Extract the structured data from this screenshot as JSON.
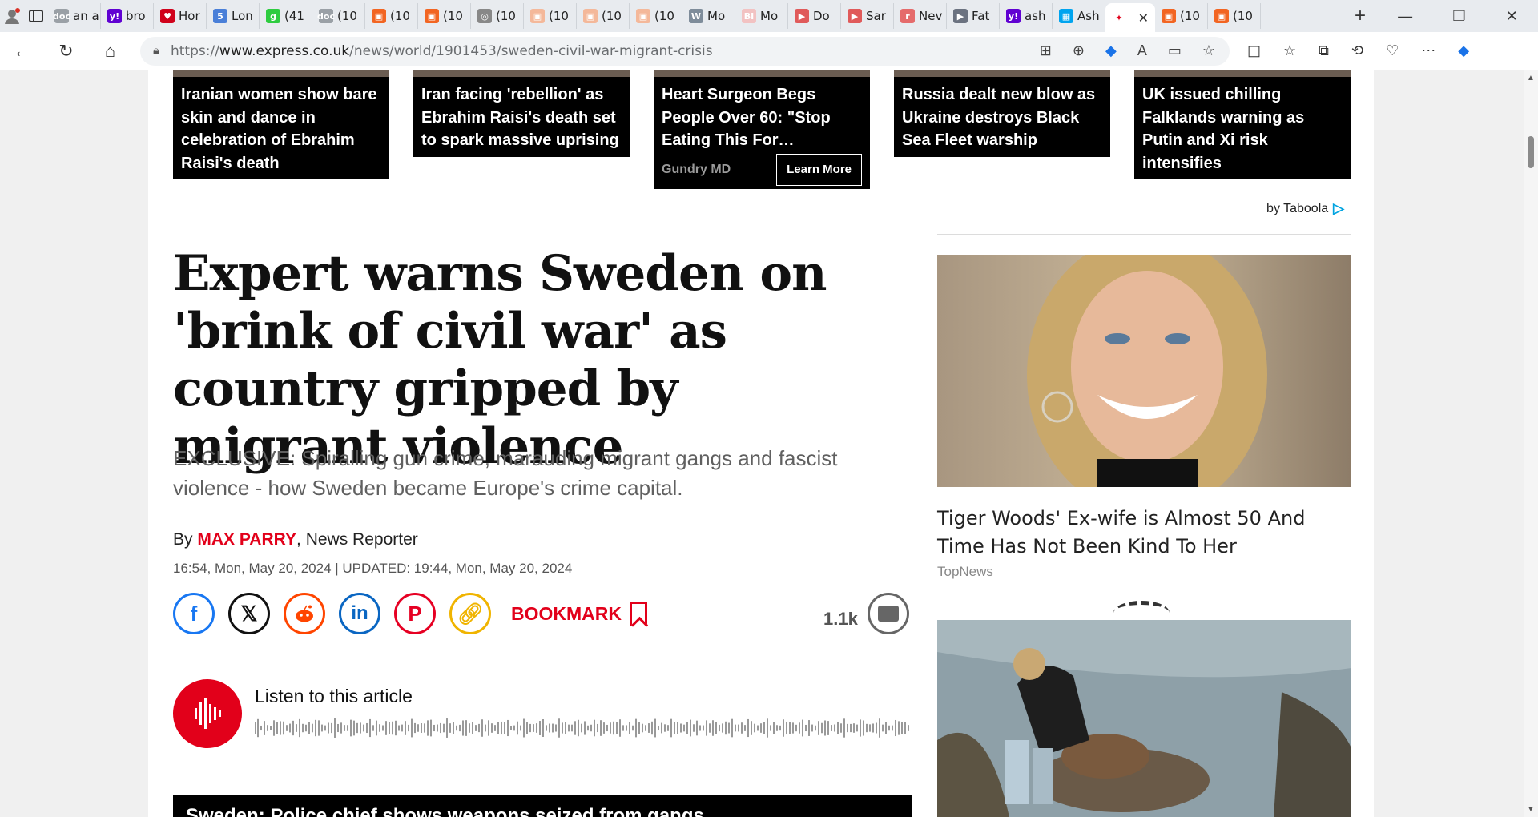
{
  "browser": {
    "tabs": [
      {
        "label": "an a",
        "fav_color": "#9aa0a6",
        "fav": "doc"
      },
      {
        "label": "bro",
        "fav_color": "#6001d2",
        "fav": "y!"
      },
      {
        "label": "Hor",
        "fav_color": "#d0021b",
        "fav": "♥"
      },
      {
        "label": "Lon",
        "fav_color": "#4a7fd8",
        "fav": "5"
      },
      {
        "label": "(41",
        "fav_color": "#2ecc40",
        "fav": "g"
      },
      {
        "label": "(10",
        "fav_color": "#9aa0a6",
        "fav": "doc"
      },
      {
        "label": "(10",
        "fav_color": "#f26522",
        "fav": "▣"
      },
      {
        "label": "(10",
        "fav_color": "#f26522",
        "fav": "▣"
      },
      {
        "label": "(10",
        "fav_color": "#888888",
        "fav": "◎"
      },
      {
        "label": "(10",
        "fav_color": "#f4b89a",
        "fav": "▣"
      },
      {
        "label": "(10",
        "fav_color": "#f4b89a",
        "fav": "▣"
      },
      {
        "label": "(10",
        "fav_color": "#f4b89a",
        "fav": "▣"
      },
      {
        "label": "Mo",
        "fav_color": "#7e8c9a",
        "fav": "W"
      },
      {
        "label": "Mo",
        "fav_color": "#f2c2c2",
        "fav": "BI"
      },
      {
        "label": "Do",
        "fav_color": "#e05a5a",
        "fav": "▶"
      },
      {
        "label": "Sar",
        "fav_color": "#e05a5a",
        "fav": "▶"
      },
      {
        "label": "Nev",
        "fav_color": "#e56b6b",
        "fav": "r"
      },
      {
        "label": "Fat",
        "fav_color": "#6b7280",
        "fav": "▶"
      },
      {
        "label": "ash",
        "fav_color": "#6001d2",
        "fav": "y!"
      },
      {
        "label": "Ash",
        "fav_color": "#00a4ef",
        "fav": "▦"
      },
      {
        "label": "",
        "fav_color": "#ffffff",
        "fav": "✦",
        "active": true
      },
      {
        "label": "(10",
        "fav_color": "#f26522",
        "fav": "▣"
      },
      {
        "label": "(10",
        "fav_color": "#f26522",
        "fav": "▣"
      }
    ],
    "url_prefix": "https://",
    "url_domain": "www.express.co.uk",
    "url_path": "/news/world/1901453/sweden-civil-war-migrant-crisis"
  },
  "taboola": {
    "cards": [
      {
        "caption": "Iranian women show bare skin and dance in celebration of Ebrahim Raisi's death"
      },
      {
        "caption": "Iran facing 'rebellion' as Ebrahim Raisi's death set to spark massive uprising"
      },
      {
        "caption": "Heart Surgeon Begs People Over 60: \"Stop Eating This For…",
        "source": "Gundry MD",
        "button": "Learn More",
        "sponsored": true
      },
      {
        "caption": "Russia dealt new blow as Ukraine destroys Black Sea Fleet warship"
      },
      {
        "caption": "UK issued chilling Falklands warning as Putin and Xi risk intensifies"
      }
    ],
    "by_label": "by Taboola"
  },
  "article": {
    "headline": "Expert warns Sweden on 'brink of civil war' as country gripped by migrant violence",
    "standfirst": "EXCLUSIVE: Spiralling gun crime, marauding migrant gangs and fascist violence - how Sweden became Europe's crime capital.",
    "by_prefix": "By",
    "author": "MAX PARRY",
    "author_role": ", News Reporter",
    "dateline": "16:54, Mon, May 20, 2024 | UPDATED: 19:44, Mon, May 20, 2024",
    "bookmark_label": "BOOKMARK",
    "comment_count": "1.1k",
    "listen_label": "Listen to this article",
    "video_title": "Sweden: Police chief shows weapons seized from gangs"
  },
  "sidebar": {
    "promo_title": "Tiger Woods' Ex-wife is Almost 50 And Time Has Not Been Kind To Her",
    "promo_source": "TopNews"
  },
  "colors": {
    "brand_red": "#e2001a",
    "taboola_blue": "#00a3e0"
  }
}
